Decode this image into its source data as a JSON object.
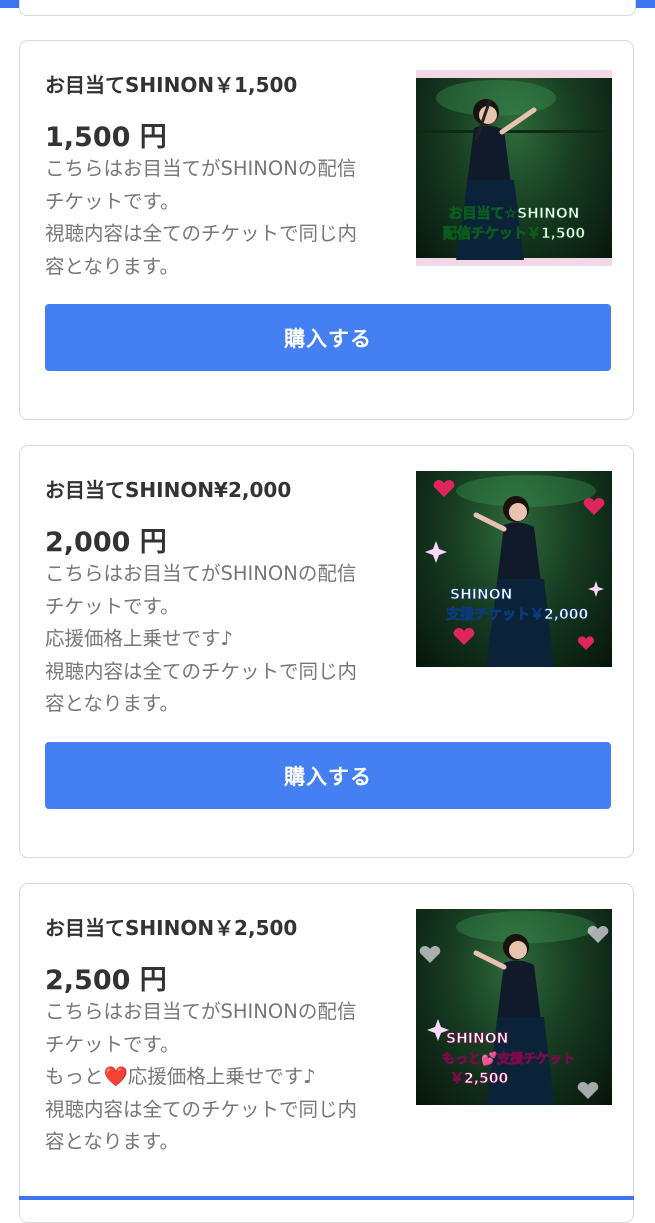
{
  "tickets": [
    {
      "title": "お目当てSHINON￥1,500",
      "price": "1,500 円",
      "description": [
        "こちらはお目当てがSHINONの配信",
        "チケットです。",
        "視聴内容は全てのチケットで同じ内",
        "容となります。"
      ],
      "button_label": "購入する",
      "image_caption": [
        "お目当て☆SHINON",
        "配信チケット￥1,500"
      ]
    },
    {
      "title": "お目当てSHINON¥2,000",
      "price": "2,000 円",
      "description": [
        "こちらはお目当てがSHINONの配信",
        "チケットです。",
        "応援価格上乗せです♪",
        "視聴内容は全てのチケットで同じ内",
        "容となります。"
      ],
      "button_label": "購入する",
      "image_caption": [
        "SHINON",
        "支援チケット￥2,000"
      ]
    },
    {
      "title": "お目当てSHINON￥2,500",
      "price": "2,500 円",
      "description": [
        "こちらはお目当てがSHINONの配信",
        "チケットです。",
        "もっと❤️応援価格上乗せです♪",
        "視聴内容は全てのチケットで同じ内",
        "容となります。"
      ],
      "image_caption": [
        "SHINON",
        "もっと💕支援チケット",
        "￥2,500"
      ]
    }
  ],
  "colors": {
    "primary": "#4480f2",
    "border": "#d9d9d9",
    "text": "#333333",
    "muted": "#777777"
  }
}
